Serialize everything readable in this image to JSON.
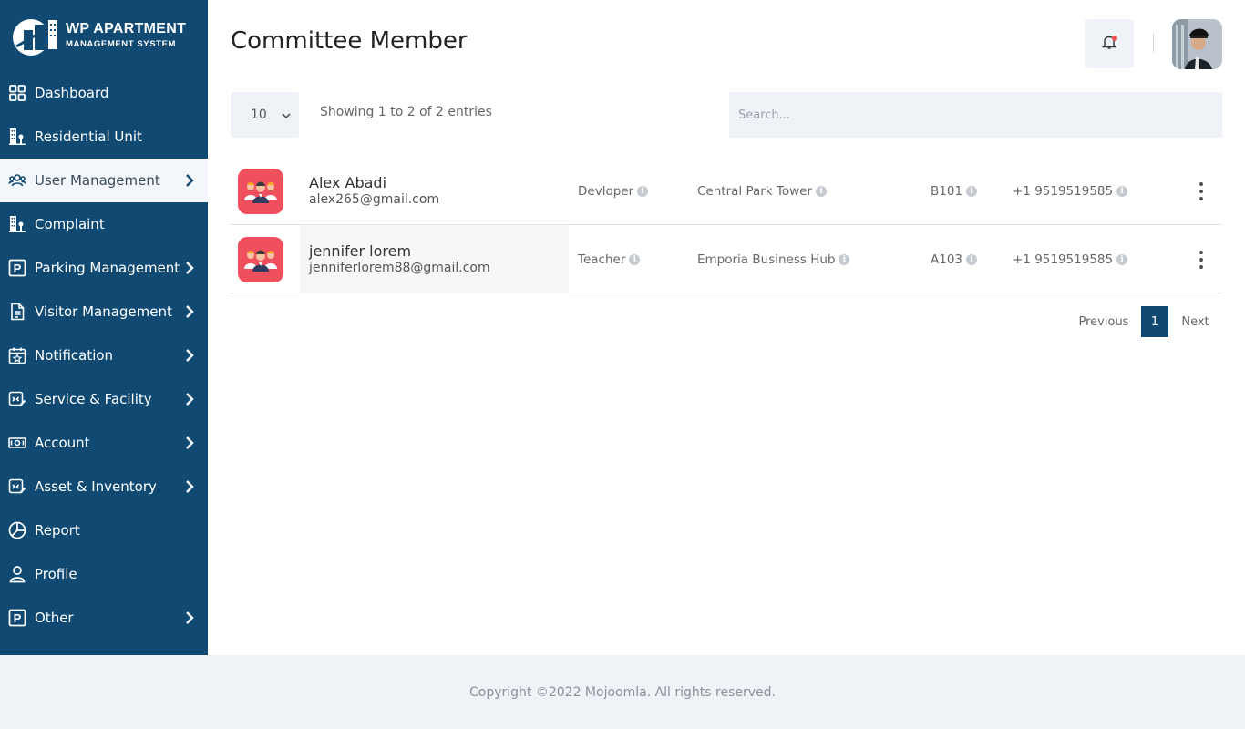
{
  "brand": {
    "title": "WP APARTMENT",
    "subtitle": "MANAGEMENT SYSTEM"
  },
  "sidebar": {
    "items": [
      {
        "label": "Dashboard",
        "icon": "grid-icon",
        "has_chevron": false,
        "active": false
      },
      {
        "label": "Residential Unit",
        "icon": "building-icon",
        "has_chevron": false,
        "active": false
      },
      {
        "label": "User Management",
        "icon": "users-icon",
        "has_chevron": true,
        "active": true
      },
      {
        "label": "Complaint",
        "icon": "building-icon",
        "has_chevron": false,
        "active": false
      },
      {
        "label": "Parking Management",
        "icon": "parking-icon",
        "has_chevron": true,
        "active": false
      },
      {
        "label": "Visitor Management",
        "icon": "document-icon",
        "has_chevron": true,
        "active": false
      },
      {
        "label": "Notification",
        "icon": "calendar-star-icon",
        "has_chevron": true,
        "active": false
      },
      {
        "label": "Service & Facility",
        "icon": "service-icon",
        "has_chevron": true,
        "active": false
      },
      {
        "label": "Account",
        "icon": "money-icon",
        "has_chevron": true,
        "active": false
      },
      {
        "label": "Asset & Inventory",
        "icon": "service-icon",
        "has_chevron": true,
        "active": false
      },
      {
        "label": "Report",
        "icon": "pie-chart-icon",
        "has_chevron": false,
        "active": false
      },
      {
        "label": "Profile",
        "icon": "person-icon",
        "has_chevron": false,
        "active": false
      },
      {
        "label": "Other",
        "icon": "parking-icon",
        "has_chevron": true,
        "active": false
      }
    ]
  },
  "header": {
    "title": "Committee Member",
    "notification_unread": true
  },
  "controls": {
    "page_size": "10",
    "showing": "Showing 1 to 2 of 2 entries",
    "search_placeholder": "Search..."
  },
  "table": {
    "rows": [
      {
        "name": "Alex Abadi",
        "email": "alex265@gmail.com",
        "role": "Devloper",
        "building": "Central Park Tower",
        "unit": "B101",
        "phone": "+1 9519519585"
      },
      {
        "name": "jennifer lorem",
        "email": "jenniferlorem88@gmail.com",
        "role": "Teacher",
        "building": "Emporia Business Hub",
        "unit": "A103",
        "phone": "+1 9519519585"
      }
    ]
  },
  "pagination": {
    "previous": "Previous",
    "current": "1",
    "next": "Next"
  },
  "footer": {
    "copyright": "Copyright ©2022 Mojoomla. All rights reserved."
  },
  "colors": {
    "sidebar_bg": "#104a73",
    "accent": "#104a73",
    "member_icon_bg": "#f0505e",
    "panel_bg": "#eff3f8"
  }
}
